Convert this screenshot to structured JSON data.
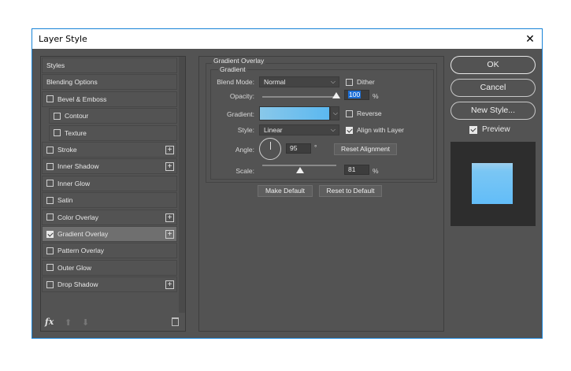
{
  "window": {
    "title": "Layer Style",
    "close_glyph": "✕"
  },
  "styles_list": {
    "items": [
      {
        "label": "Styles",
        "has_checkbox": false,
        "checked": false,
        "has_plus": false
      },
      {
        "label": "Blending Options",
        "has_checkbox": false,
        "checked": false,
        "has_plus": false
      },
      {
        "label": "Bevel & Emboss",
        "has_checkbox": true,
        "checked": false,
        "has_plus": false
      },
      {
        "label": "Contour",
        "has_checkbox": true,
        "checked": false,
        "has_plus": false,
        "indent": true
      },
      {
        "label": "Texture",
        "has_checkbox": true,
        "checked": false,
        "has_plus": false,
        "indent": true
      },
      {
        "label": "Stroke",
        "has_checkbox": true,
        "checked": false,
        "has_plus": true
      },
      {
        "label": "Inner Shadow",
        "has_checkbox": true,
        "checked": false,
        "has_plus": true
      },
      {
        "label": "Inner Glow",
        "has_checkbox": true,
        "checked": false,
        "has_plus": false
      },
      {
        "label": "Satin",
        "has_checkbox": true,
        "checked": false,
        "has_plus": false
      },
      {
        "label": "Color Overlay",
        "has_checkbox": true,
        "checked": false,
        "has_plus": true
      },
      {
        "label": "Gradient Overlay",
        "has_checkbox": true,
        "checked": true,
        "has_plus": true,
        "selected": true
      },
      {
        "label": "Pattern Overlay",
        "has_checkbox": true,
        "checked": false,
        "has_plus": false
      },
      {
        "label": "Outer Glow",
        "has_checkbox": true,
        "checked": false,
        "has_plus": false
      },
      {
        "label": "Drop Shadow",
        "has_checkbox": true,
        "checked": false,
        "has_plus": true
      }
    ],
    "fx_label": "fx"
  },
  "gradient_overlay": {
    "section_title": "Gradient Overlay",
    "subsection_title": "Gradient",
    "blend_mode_label": "Blend Mode:",
    "blend_mode_value": "Normal",
    "dither_label": "Dither",
    "dither_checked": false,
    "opacity_label": "Opacity:",
    "opacity_value": "100",
    "opacity_unit": "%",
    "opacity_fraction": 1.0,
    "gradient_label": "Gradient:",
    "reverse_label": "Reverse",
    "reverse_checked": false,
    "style_label": "Style:",
    "style_value": "Linear",
    "align_label": "Align with Layer",
    "align_checked": true,
    "angle_label": "Angle:",
    "angle_value": "95",
    "angle_unit": "°",
    "reset_alignment_label": "Reset Alignment",
    "scale_label": "Scale:",
    "scale_value": "81",
    "scale_unit": "%",
    "make_default_label": "Make Default",
    "reset_default_label": "Reset to Default",
    "colors": {
      "gradient_start": "#89c8ea",
      "gradient_end": "#5bb8f0"
    }
  },
  "actions": {
    "ok_label": "OK",
    "cancel_label": "Cancel",
    "new_style_label": "New Style...",
    "preview_label": "Preview",
    "preview_checked": true
  }
}
